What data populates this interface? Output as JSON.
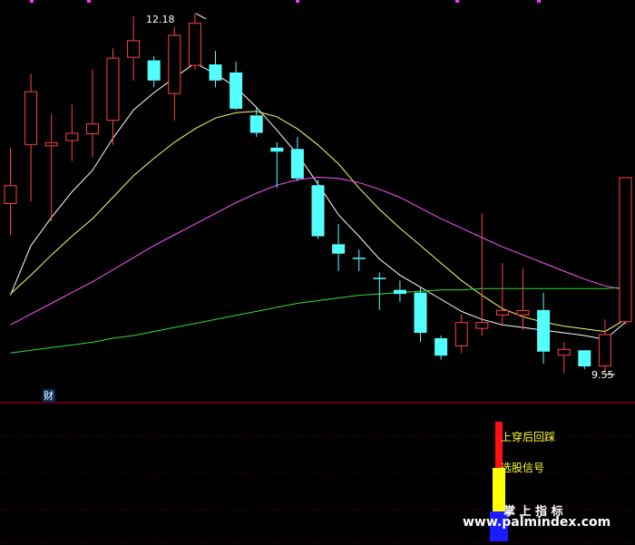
{
  "chart_data": {
    "type": "candlestick",
    "price_range": [
      9.3,
      12.3
    ],
    "high_label": "12.18",
    "low_label": "9.55",
    "candles": [
      {
        "o": 10.78,
        "h": 11.2,
        "l": 10.55,
        "c": 10.92
      },
      {
        "o": 11.22,
        "h": 11.75,
        "l": 10.8,
        "c": 11.62
      },
      {
        "o": 11.21,
        "h": 11.45,
        "l": 10.65,
        "c": 11.24
      },
      {
        "o": 11.25,
        "h": 11.52,
        "l": 11.1,
        "c": 11.31
      },
      {
        "o": 11.3,
        "h": 11.78,
        "l": 11.13,
        "c": 11.38
      },
      {
        "o": 11.4,
        "h": 11.94,
        "l": 11.22,
        "c": 11.87
      },
      {
        "o": 11.87,
        "h": 12.18,
        "l": 11.7,
        "c": 12.0
      },
      {
        "o": 11.85,
        "h": 11.88,
        "l": 11.65,
        "c": 11.7
      },
      {
        "o": 11.6,
        "h": 12.1,
        "l": 11.4,
        "c": 12.04
      },
      {
        "o": 11.81,
        "h": 12.2,
        "l": 11.78,
        "c": 12.13
      },
      {
        "o": 11.82,
        "h": 11.92,
        "l": 11.65,
        "c": 11.7
      },
      {
        "o": 11.76,
        "h": 11.84,
        "l": 11.48,
        "c": 11.49
      },
      {
        "o": 11.44,
        "h": 11.5,
        "l": 11.28,
        "c": 11.31
      },
      {
        "o": 11.2,
        "h": 11.24,
        "l": 10.9,
        "c": 11.17
      },
      {
        "o": 11.19,
        "h": 11.28,
        "l": 10.95,
        "c": 10.97
      },
      {
        "o": 10.92,
        "h": 10.96,
        "l": 10.52,
        "c": 10.54
      },
      {
        "o": 10.48,
        "h": 10.63,
        "l": 10.28,
        "c": 10.41
      },
      {
        "o": 10.38,
        "h": 10.44,
        "l": 10.28,
        "c": 10.37
      },
      {
        "o": 10.23,
        "h": 10.27,
        "l": 9.99,
        "c": 10.22
      },
      {
        "o": 10.14,
        "h": 10.21,
        "l": 10.05,
        "c": 10.11
      },
      {
        "o": 10.12,
        "h": 10.16,
        "l": 9.75,
        "c": 9.82
      },
      {
        "o": 9.78,
        "h": 9.8,
        "l": 9.62,
        "c": 9.65
      },
      {
        "o": 9.72,
        "h": 9.96,
        "l": 9.67,
        "c": 9.9
      },
      {
        "o": 9.85,
        "h": 10.71,
        "l": 9.8,
        "c": 9.9
      },
      {
        "o": 9.95,
        "h": 10.34,
        "l": 9.87,
        "c": 9.99
      },
      {
        "o": 9.95,
        "h": 10.3,
        "l": 9.84,
        "c": 9.99
      },
      {
        "o": 9.99,
        "h": 10.12,
        "l": 9.59,
        "c": 9.68
      },
      {
        "o": 9.65,
        "h": 9.75,
        "l": 9.52,
        "c": 9.7
      },
      {
        "o": 9.69,
        "h": 9.69,
        "l": 9.55,
        "c": 9.57
      },
      {
        "o": 9.57,
        "h": 9.92,
        "l": 9.51,
        "c": 9.81
      },
      {
        "o": 9.9,
        "h": 10.98,
        "l": 9.88,
        "c": 10.98
      }
    ],
    "series": [
      {
        "name": "ma5",
        "color": "#ffffff",
        "values": [
          10.1,
          10.47,
          10.68,
          10.87,
          11.03,
          11.27,
          11.48,
          11.61,
          11.72,
          11.83,
          11.75,
          11.65,
          11.5,
          11.33,
          11.15,
          10.93,
          10.7,
          10.54,
          10.37,
          10.25,
          10.16,
          10.07,
          9.98,
          9.92,
          9.88,
          9.86,
          9.84,
          9.82,
          9.8,
          9.77,
          9.9
        ]
      },
      {
        "name": "ma10",
        "color": "#ffff66",
        "values": [
          10.11,
          10.25,
          10.4,
          10.54,
          10.67,
          10.83,
          10.99,
          11.12,
          11.24,
          11.34,
          11.42,
          11.46,
          11.47,
          11.43,
          11.34,
          11.22,
          11.08,
          10.9,
          10.74,
          10.6,
          10.47,
          10.34,
          10.21,
          10.1,
          10.0,
          9.94,
          9.9,
          9.87,
          9.85,
          9.83,
          9.92
        ]
      },
      {
        "name": "ma20",
        "color": "#ff55ff",
        "values": [
          9.88,
          9.96,
          10.04,
          10.12,
          10.2,
          10.29,
          10.38,
          10.47,
          10.55,
          10.63,
          10.71,
          10.79,
          10.86,
          10.92,
          10.96,
          10.98,
          10.97,
          10.94,
          10.89,
          10.83,
          10.75,
          10.67,
          10.6,
          10.53,
          10.46,
          10.4,
          10.34,
          10.28,
          10.22,
          10.17,
          10.14
        ]
      },
      {
        "name": "ma60",
        "color": "#33dd33",
        "values": [
          9.67,
          9.69,
          9.71,
          9.73,
          9.75,
          9.78,
          9.8,
          9.83,
          9.86,
          9.89,
          9.92,
          9.95,
          9.98,
          10.01,
          10.04,
          10.06,
          10.08,
          10.1,
          10.11,
          10.12,
          10.13,
          10.14,
          10.14,
          10.15,
          10.15,
          10.15,
          10.15,
          10.15,
          10.15,
          10.15,
          10.16
        ]
      }
    ],
    "colors": {
      "up": "#ff4444",
      "down": "#54ffff",
      "separator": "#b4001e",
      "grid": "#7a0000",
      "label": "#ffffff",
      "signal1": "#ff1010",
      "signal2": "#ffff00",
      "signal3": "#1b1bff",
      "indicator_text": "#ffff33",
      "cai_text": "#ffffff",
      "cai_bg": "#0a2a5a"
    },
    "indicator": {
      "cai_label": "财",
      "signal1_label": "上穿后回踩",
      "signal2_label": "选股信号"
    }
  },
  "watermark": {
    "title": "掌 上 指 标",
    "url": "www.palmindex.com"
  }
}
